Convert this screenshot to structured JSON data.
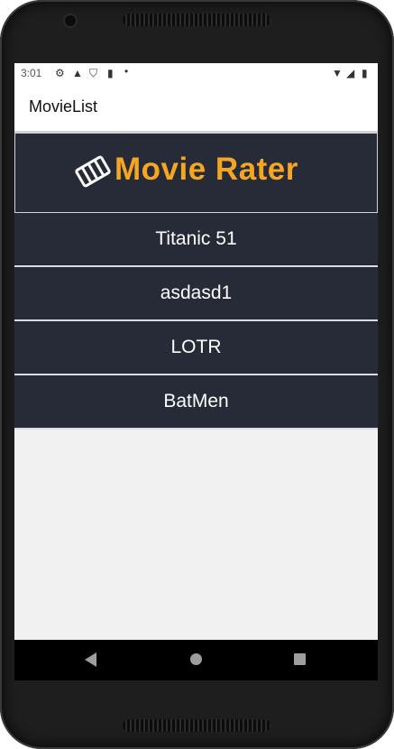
{
  "status_bar": {
    "time": "3:01",
    "icons": [
      "settings-icon",
      "navigation-icon",
      "shield-icon",
      "sd-card-icon",
      "dot-icon",
      "wifi-icon",
      "signal-icon",
      "battery-icon"
    ]
  },
  "app_bar": {
    "title": "MovieList"
  },
  "banner": {
    "text": "Movie Rater",
    "logo_icon": "film-strip-icon",
    "text_color": "#f5a623",
    "background": "#262b37"
  },
  "movies": [
    {
      "title": "Titanic 51"
    },
    {
      "title": "asdasd1"
    },
    {
      "title": "LOTR"
    },
    {
      "title": "BatMen"
    }
  ],
  "nav_bar": {
    "buttons": [
      "back-icon",
      "home-icon",
      "recents-icon"
    ]
  }
}
